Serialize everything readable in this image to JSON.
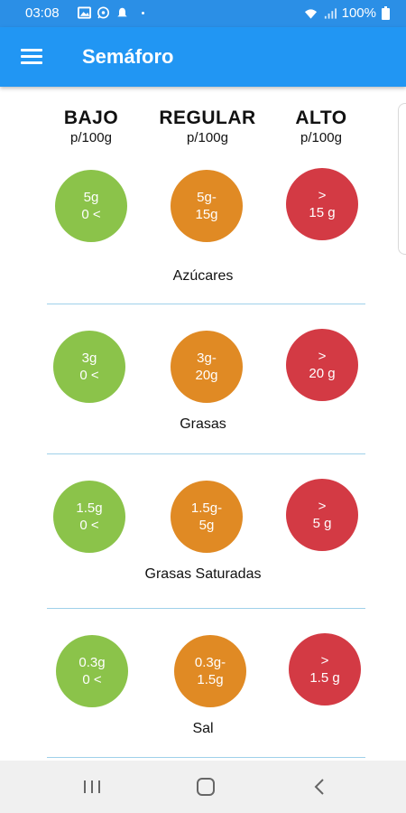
{
  "status_bar": {
    "time": "03:08",
    "battery": "100%",
    "icons_left": [
      "image-icon",
      "whatsapp-icon",
      "notification-icon"
    ],
    "icons_right": [
      "wifi-icon",
      "signal-icon",
      "battery-icon"
    ]
  },
  "app_bar": {
    "title": "Semáforo",
    "menu_icon": "hamburger-menu-icon"
  },
  "columns": [
    {
      "heading": "BAJO",
      "sub": "p/100g",
      "color": "#8bc34a"
    },
    {
      "heading": "REGULAR",
      "sub": "p/100g",
      "color": "#e08a24"
    },
    {
      "heading": "ALTO",
      "sub": "p/100g",
      "color": "#d33a44"
    }
  ],
  "sections": [
    {
      "label": "Azúcares",
      "bajo": [
        "5g",
        "0 <"
      ],
      "regular": [
        "5g-",
        "15g"
      ],
      "alto": [
        ">",
        "15 g"
      ]
    },
    {
      "label": "Grasas",
      "bajo": [
        "3g",
        "0 <"
      ],
      "regular": [
        "3g-",
        "20g"
      ],
      "alto": [
        ">",
        "20 g"
      ]
    },
    {
      "label": "Grasas Saturadas",
      "bajo": [
        "1.5g",
        "0 <"
      ],
      "regular": [
        "1.5g-",
        "5g"
      ],
      "alto": [
        ">",
        "5 g"
      ]
    },
    {
      "label": "Sal",
      "bajo": [
        "0.3g",
        "0 <"
      ],
      "regular": [
        "0.3g-",
        "1.5g"
      ],
      "alto": [
        ">",
        "1.5 g"
      ]
    }
  ],
  "nav_bar": {
    "buttons": [
      "recents-icon",
      "home-icon",
      "back-icon"
    ]
  }
}
